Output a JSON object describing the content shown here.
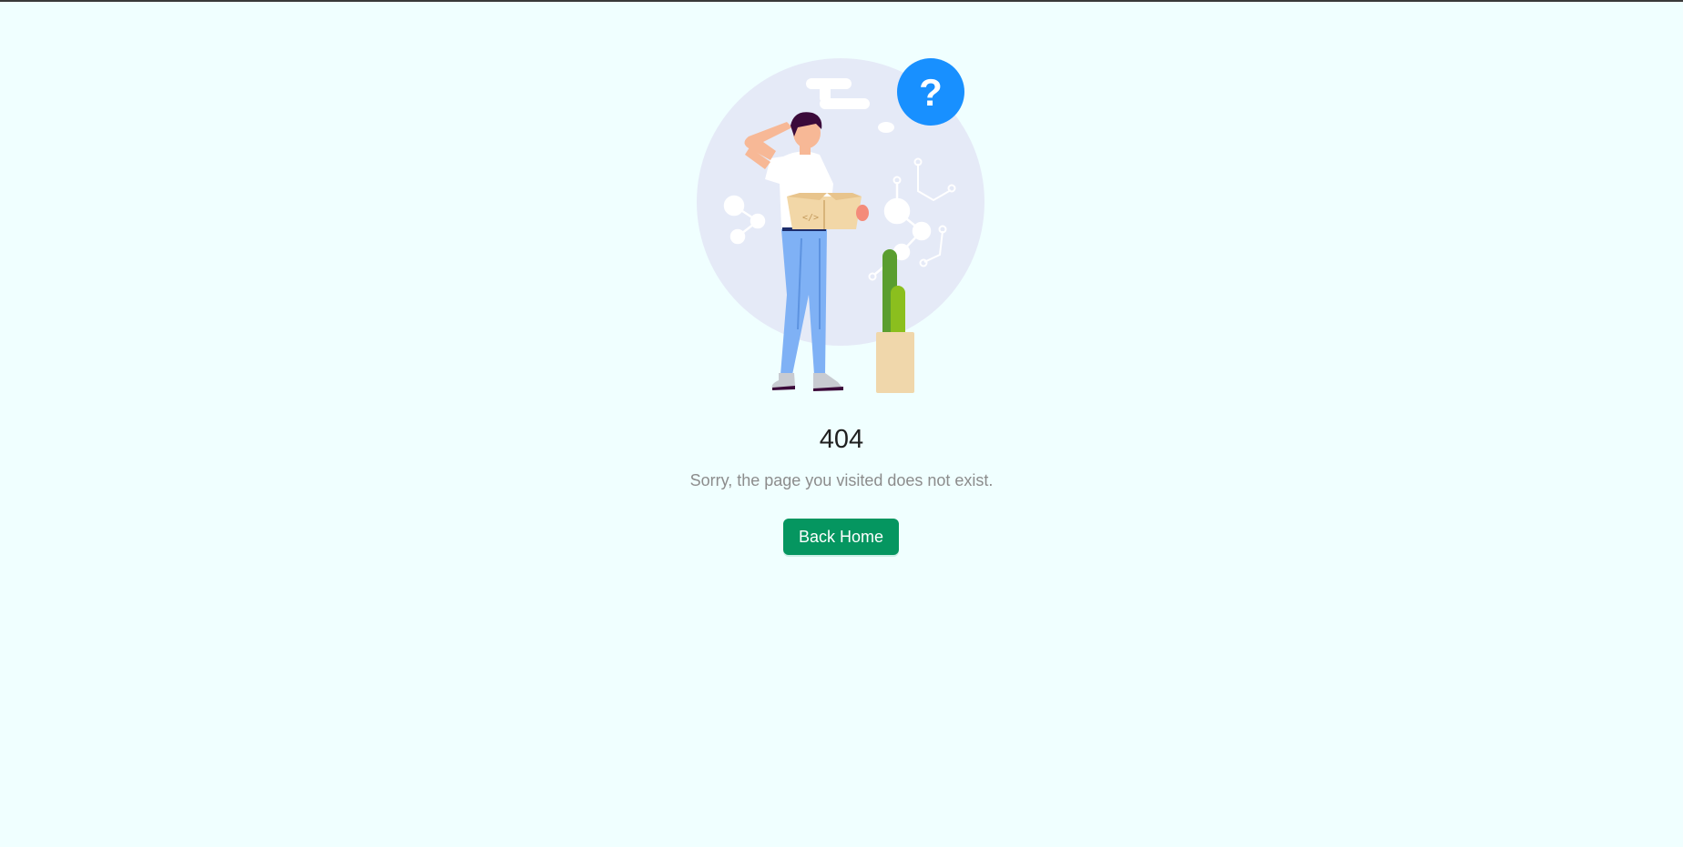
{
  "result": {
    "status_code": "404",
    "subtitle": "Sorry, the page you visited does not exist.",
    "back_button_label": "Back Home",
    "illustration": "404-confused-person-with-box-illustration",
    "question_mark": "?"
  },
  "colors": {
    "background": "#f0ffff",
    "button": "#059660",
    "button_text": "#ffffff",
    "title": "#1f1f1f",
    "subtitle": "#8c8c8c",
    "question_bubble": "#1890ff",
    "backdrop_circle": "#e5eaf7"
  }
}
